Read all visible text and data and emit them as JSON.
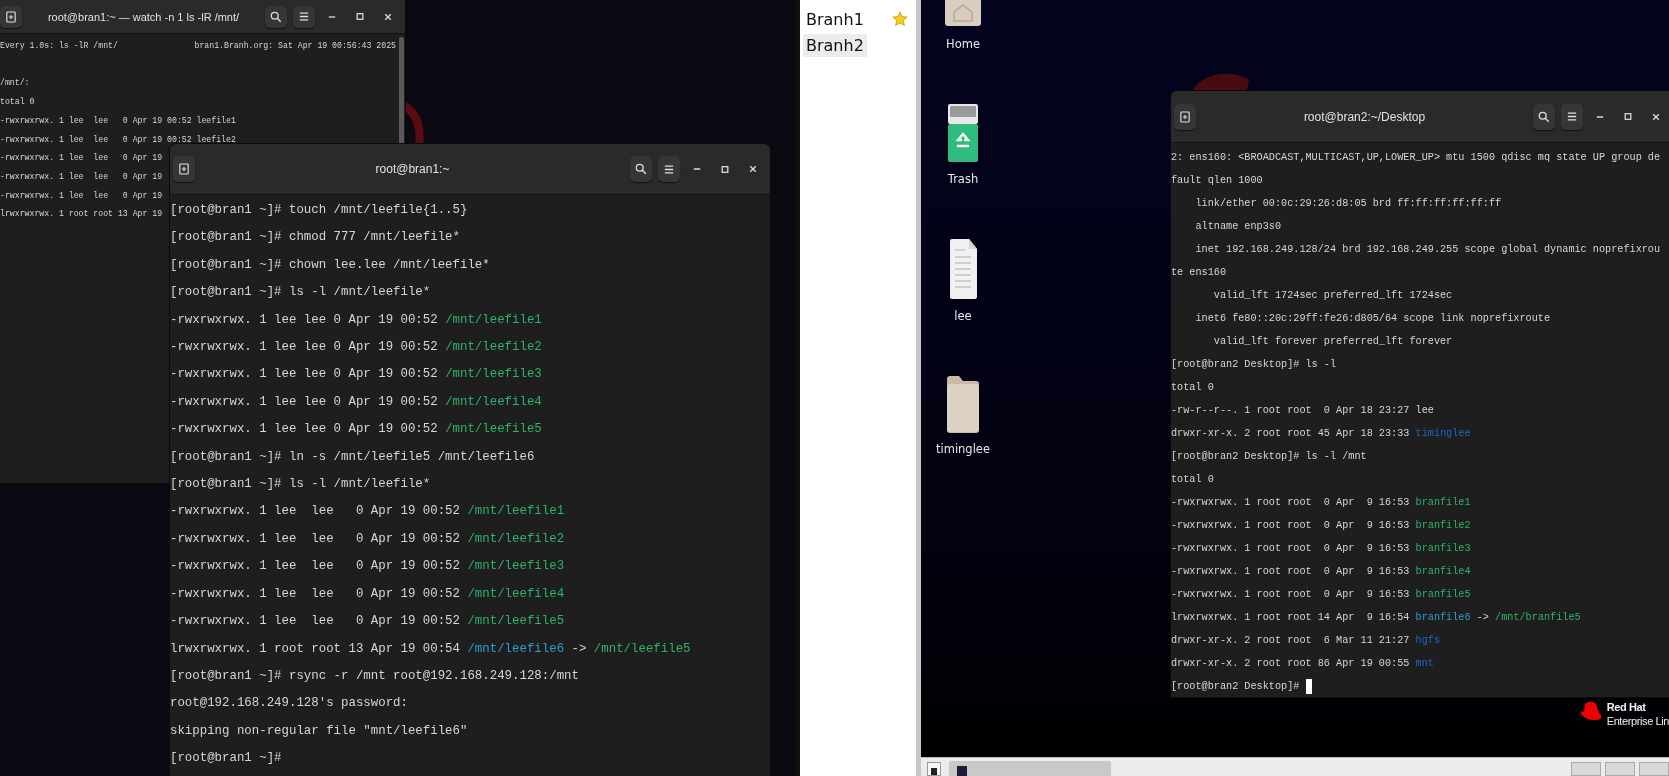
{
  "back_terminal": {
    "title": "root@bran1:~ — watch -n 1 ls -lR /mnt/",
    "header": {
      "command": "Every 1.0s: ls -lR /mnt/",
      "host_time": "bran1.Branh.org: Sat Apr 19 00:56:43 2025"
    },
    "lines": [
      {
        "parts": [
          {
            "text": "/mnt/:"
          }
        ]
      },
      {
        "parts": [
          {
            "text": "total 0"
          }
        ]
      },
      {
        "parts": [
          {
            "text": "-rwxrwxrwx. 1 lee  lee   0 Apr 19 00:52 leefile1"
          }
        ]
      },
      {
        "parts": [
          {
            "text": "-rwxrwxrwx. 1 lee  lee   0 Apr 19 00:52 leefile2"
          }
        ]
      },
      {
        "parts": [
          {
            "text": "-rwxrwxrwx. 1 lee  lee   0 Apr 19"
          }
        ]
      },
      {
        "parts": [
          {
            "text": "-rwxrwxrwx. 1 lee  lee   0 Apr 19"
          }
        ]
      },
      {
        "parts": [
          {
            "text": "-rwxrwxrwx. 1 lee  lee   0 Apr 19"
          }
        ]
      },
      {
        "parts": [
          {
            "text": "lrwxrwxrwx. 1 root root 13 Apr 19"
          }
        ]
      }
    ]
  },
  "front_terminal": {
    "title": "root@bran1:~",
    "lines": [
      {
        "parts": [
          {
            "text": "[root@bran1 ~]# touch /mnt/leefile{1..5}"
          }
        ]
      },
      {
        "parts": [
          {
            "text": "[root@bran1 ~]# chmod 777 /mnt/leefile*"
          }
        ]
      },
      {
        "parts": [
          {
            "text": "[root@bran1 ~]# chown lee.lee /mnt/leefile*"
          }
        ]
      },
      {
        "parts": [
          {
            "text": "[root@bran1 ~]# ls -l /mnt/leefile*"
          }
        ]
      },
      {
        "parts": [
          {
            "text": "-rwxrwxrwx. 1 lee lee 0 Apr 19 00:52 "
          },
          {
            "text": "/mnt/leefile1",
            "kind": "exec"
          }
        ]
      },
      {
        "parts": [
          {
            "text": "-rwxrwxrwx. 1 lee lee 0 Apr 19 00:52 "
          },
          {
            "text": "/mnt/leefile2",
            "kind": "exec"
          }
        ]
      },
      {
        "parts": [
          {
            "text": "-rwxrwxrwx. 1 lee lee 0 Apr 19 00:52 "
          },
          {
            "text": "/mnt/leefile3",
            "kind": "exec"
          }
        ]
      },
      {
        "parts": [
          {
            "text": "-rwxrwxrwx. 1 lee lee 0 Apr 19 00:52 "
          },
          {
            "text": "/mnt/leefile4",
            "kind": "exec"
          }
        ]
      },
      {
        "parts": [
          {
            "text": "-rwxrwxrwx. 1 lee lee 0 Apr 19 00:52 "
          },
          {
            "text": "/mnt/leefile5",
            "kind": "exec"
          }
        ]
      },
      {
        "parts": [
          {
            "text": "[root@bran1 ~]# ln -s /mnt/leefile5 /mnt/leefile6"
          }
        ]
      },
      {
        "parts": [
          {
            "text": "[root@bran1 ~]# ls -l /mnt/leefile*"
          }
        ]
      },
      {
        "parts": [
          {
            "text": "-rwxrwxrwx. 1 lee  lee   0 Apr 19 00:52 "
          },
          {
            "text": "/mnt/leefile1",
            "kind": "exec"
          }
        ]
      },
      {
        "parts": [
          {
            "text": "-rwxrwxrwx. 1 lee  lee   0 Apr 19 00:52 "
          },
          {
            "text": "/mnt/leefile2",
            "kind": "exec"
          }
        ]
      },
      {
        "parts": [
          {
            "text": "-rwxrwxrwx. 1 lee  lee   0 Apr 19 00:52 "
          },
          {
            "text": "/mnt/leefile3",
            "kind": "exec"
          }
        ]
      },
      {
        "parts": [
          {
            "text": "-rwxrwxrwx. 1 lee  lee   0 Apr 19 00:52 "
          },
          {
            "text": "/mnt/leefile4",
            "kind": "exec"
          }
        ]
      },
      {
        "parts": [
          {
            "text": "-rwxrwxrwx. 1 lee  lee   0 Apr 19 00:52 "
          },
          {
            "text": "/mnt/leefile5",
            "kind": "exec"
          }
        ]
      },
      {
        "parts": [
          {
            "text": "lrwxrwxrwx. 1 root root 13 Apr 19 00:54 "
          },
          {
            "text": "/mnt/leefile6",
            "kind": "link"
          },
          {
            "text": " -> "
          },
          {
            "text": "/mnt/leefile5",
            "kind": "exec"
          }
        ]
      },
      {
        "parts": [
          {
            "text": "[root@bran1 ~]# rsync -r /mnt root@192.168.249.128:/mnt"
          }
        ]
      },
      {
        "parts": [
          {
            "text": "root@192.168.249.128's password:"
          }
        ]
      },
      {
        "parts": [
          {
            "text": "skipping non-regular file \"mnt/leefile6\""
          }
        ]
      },
      {
        "parts": [
          {
            "text": "[root@bran1 ~]#"
          }
        ]
      }
    ]
  },
  "sidebar": {
    "items": [
      {
        "label": "Branh1",
        "selected": false,
        "starred": true
      },
      {
        "label": "Branh2",
        "selected": true,
        "starred": false
      }
    ]
  },
  "desktop_icons": [
    {
      "label": "Home",
      "kind": "home"
    },
    {
      "label": "Trash",
      "kind": "trash"
    },
    {
      "label": "lee",
      "kind": "document"
    },
    {
      "label": "timinglee",
      "kind": "folder"
    }
  ],
  "vm_terminal": {
    "title": "root@bran2:~/Desktop",
    "cursor": true,
    "lines": [
      {
        "parts": [
          {
            "text": "2: ens160: <BROADCAST,MULTICAST,UP,LOWER_UP> mtu 1500 qdisc mq state UP group de"
          }
        ]
      },
      {
        "parts": [
          {
            "text": "fault qlen 1000"
          }
        ]
      },
      {
        "parts": [
          {
            "text": "    link/ether 00:0c:29:26:d8:05 brd ff:ff:ff:ff:ff:ff"
          }
        ]
      },
      {
        "parts": [
          {
            "text": "    altname enp3s0"
          }
        ]
      },
      {
        "parts": [
          {
            "text": "    inet 192.168.249.128/24 brd 192.168.249.255 scope global dynamic noprefixrou"
          }
        ]
      },
      {
        "parts": [
          {
            "text": "te ens160"
          }
        ]
      },
      {
        "parts": [
          {
            "text": "       valid_lft 1724sec preferred_lft 1724sec"
          }
        ]
      },
      {
        "parts": [
          {
            "text": "    inet6 fe80::20c:29ff:fe26:d805/64 scope link noprefixroute"
          }
        ]
      },
      {
        "parts": [
          {
            "text": "       valid_lft forever preferred_lft forever"
          }
        ]
      },
      {
        "parts": [
          {
            "text": "[root@bran2 Desktop]# ls -l"
          }
        ]
      },
      {
        "parts": [
          {
            "text": "total 0"
          }
        ]
      },
      {
        "parts": [
          {
            "text": "-rw-r--r--. 1 root root  0 Apr 18 23:27 lee"
          }
        ]
      },
      {
        "parts": [
          {
            "text": "drwxr-xr-x. 2 root root 45 Apr 18 23:33 "
          },
          {
            "text": "timinglee",
            "kind": "dir"
          }
        ]
      },
      {
        "parts": [
          {
            "text": "[root@bran2 Desktop]# ls -l /mnt"
          }
        ]
      },
      {
        "parts": [
          {
            "text": "total 0"
          }
        ]
      },
      {
        "parts": [
          {
            "text": "-rwxrwxrwx. 1 root root  0 Apr  9 16:53 "
          },
          {
            "text": "branfile1",
            "kind": "exec"
          }
        ]
      },
      {
        "parts": [
          {
            "text": "-rwxrwxrwx. 1 root root  0 Apr  9 16:53 "
          },
          {
            "text": "branfile2",
            "kind": "exec"
          }
        ]
      },
      {
        "parts": [
          {
            "text": "-rwxrwxrwx. 1 root root  0 Apr  9 16:53 "
          },
          {
            "text": "branfile3",
            "kind": "exec"
          }
        ]
      },
      {
        "parts": [
          {
            "text": "-rwxrwxrwx. 1 root root  0 Apr  9 16:53 "
          },
          {
            "text": "branfile4",
            "kind": "exec"
          }
        ]
      },
      {
        "parts": [
          {
            "text": "-rwxrwxrwx. 1 root root  0 Apr  9 16:53 "
          },
          {
            "text": "branfile5",
            "kind": "exec"
          }
        ]
      },
      {
        "parts": [
          {
            "text": "lrwxrwxrwx. 1 root root 14 Apr  9 16:54 "
          },
          {
            "text": "branfile6",
            "kind": "link"
          },
          {
            "text": " -> "
          },
          {
            "text": "/mnt/branfile5",
            "kind": "exec"
          }
        ]
      },
      {
        "parts": [
          {
            "text": "drwxr-xr-x. 2 root root  6 Mar 11 21:27 "
          },
          {
            "text": "hgfs",
            "kind": "dir"
          }
        ]
      },
      {
        "parts": [
          {
            "text": "drwxr-xr-x. 2 root root 86 Apr 19 00:55 "
          },
          {
            "text": "mnt",
            "kind": "dir"
          }
        ]
      },
      {
        "parts": [
          {
            "text": "[root@bran2 Desktop]# "
          }
        ]
      }
    ]
  },
  "logo": {
    "line1": "Red Hat",
    "line2": "Enterprise Lin"
  }
}
